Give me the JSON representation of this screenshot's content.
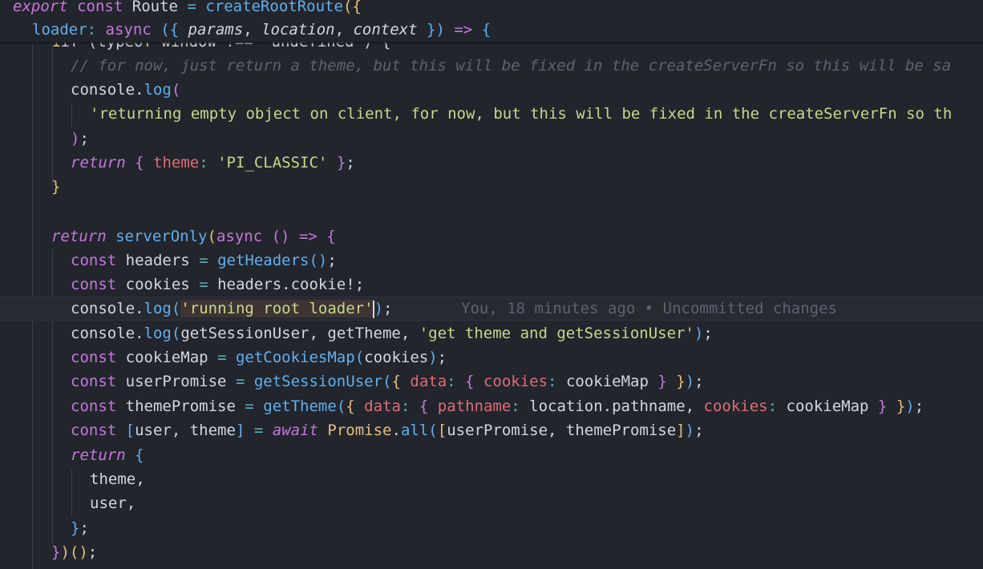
{
  "editor": {
    "sticky": {
      "line1": {
        "kw1": "export",
        "kw2": "const",
        "name": "Route",
        "eq": "=",
        "fn": "createRootRoute",
        "open": "({"
      },
      "line2": {
        "prop": "loader",
        "colon": ":",
        "kw": "async",
        "open": "({",
        "p1": "params",
        "p2": "location",
        "p3": "context",
        "close": "})",
        "arrow": "=>",
        "brace": "{"
      }
    },
    "lines": {
      "partial": "if (typeof window !== 'undefined') {",
      "comment": "// for now, just return a theme, but this will be fixed in the createServerFn so this will be sa",
      "log1_obj": "console",
      "log1_fn": "log",
      "log1_open": "(",
      "log1_str": "'returning empty object on client, for now, but this will be fixed in the createServerFn so th",
      "log1_close": ");",
      "ret1_kw": "return",
      "ret1_prop": "theme",
      "ret1_str": "'PI_CLASSIC'",
      "close_brace": "}",
      "ret2_kw": "return",
      "ret2_fn": "serverOnly",
      "ret2_kw2": "async",
      "ret2_arrow": "=>",
      "h_kw": "const",
      "h_var": "headers",
      "h_fn": "getHeaders",
      "c_kw": "const",
      "c_var": "cookies",
      "c_expr": "headers.cookie!",
      "log2_obj": "console",
      "log2_fn": "log",
      "log2_str": "running root loader",
      "blame": "You, 18 minutes ago • Uncommitted changes",
      "log3_obj": "console",
      "log3_fn": "log",
      "log3_args": "getSessionUser, getTheme, ",
      "log3_str": "'get theme and getSessionUser'",
      "cm_kw": "const",
      "cm_var": "cookieMap",
      "cm_fn": "getCookiesMap",
      "cm_arg": "cookies",
      "up_kw": "const",
      "up_var": "userPromise",
      "up_fn": "getSessionUser",
      "up_p1": "data",
      "up_p2": "cookies",
      "up_val": "cookieMap",
      "tp_kw": "const",
      "tp_var": "themePromise",
      "tp_fn": "getTheme",
      "tp_p1": "data",
      "tp_p2": "pathname",
      "tp_v2": "location.pathname",
      "tp_p3": "cookies",
      "tp_v3": "cookieMap",
      "aw_kw": "const",
      "aw_vars": "user, theme",
      "aw_await": "await",
      "aw_cls": "Promise",
      "aw_fn": "all",
      "aw_args": "userPromise, themePromise",
      "ret3_kw": "return",
      "ret3_theme": "theme,",
      "ret3_user": "user,",
      "ret3_close": "};",
      "final": "})();"
    }
  }
}
